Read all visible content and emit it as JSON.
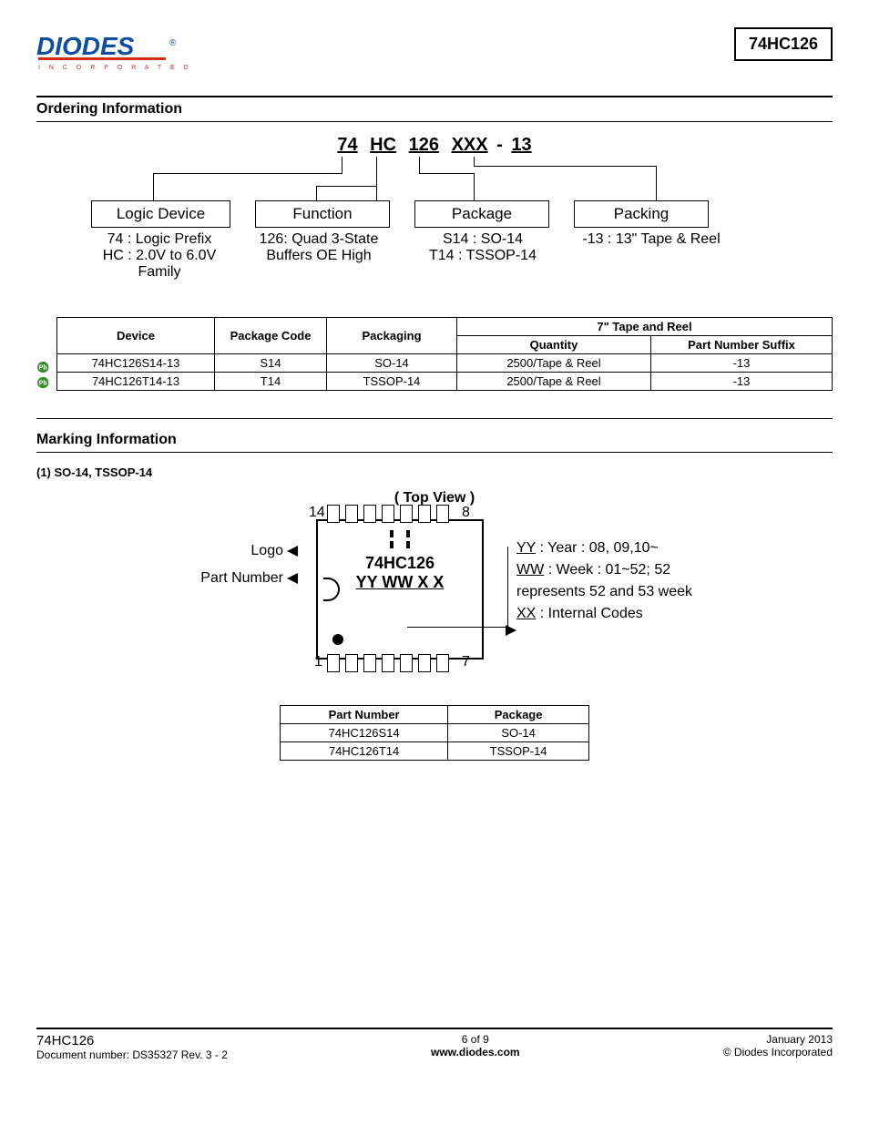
{
  "header": {
    "part_number": "74HC126"
  },
  "section1": {
    "title": "Ordering Information",
    "pn_format": {
      "p1": "74",
      "p2": "HC",
      "p3": "126",
      "p4": "XXX",
      "dash": "-",
      "p5": "13"
    },
    "groups": {
      "logic": {
        "label": "Logic Device",
        "line1": "74 : Logic Prefix",
        "line2": "HC : 2.0V to 6.0V",
        "line3": "Family"
      },
      "function": {
        "label": "Function",
        "line1": "126: Quad 3-State",
        "line2": "Buffers OE High"
      },
      "package": {
        "label": "Package",
        "line1": "S14 : SO-14",
        "line2": "T14 : TSSOP-14"
      },
      "packing": {
        "label": "Packing",
        "line1": "-13 : 13\" Tape & Reel"
      }
    }
  },
  "table1": {
    "headers": {
      "device": "Device",
      "pkgcode": "Package Code",
      "packaging": "Packaging",
      "tapereel": "7\" Tape and Reel",
      "qty": "Quantity",
      "suffix": "Part Number Suffix"
    },
    "rows": [
      {
        "device": "74HC126S14-13",
        "pkgcode": "S14",
        "packaging": "SO-14",
        "qty": "2500/Tape & Reel",
        "suffix": "-13"
      },
      {
        "device": "74HC126T14-13",
        "pkgcode": "T14",
        "packaging": "TSSOP-14",
        "qty": "2500/Tape & Reel",
        "suffix": "-13"
      }
    ]
  },
  "section2": {
    "title": "Marking Information",
    "subtitle": "(1) SO-14, TSSOP-14",
    "topview": "( Top View )",
    "pins": {
      "tl": "14",
      "tr": "8",
      "bl": "1",
      "br": "7"
    },
    "labels": {
      "logo": "Logo",
      "partno": "Part Number"
    },
    "chip": {
      "pn": "74HC126",
      "date": "YY WW X X"
    },
    "legend": {
      "l1a": "YY",
      "l1b": " : Year : 08, 09,10~",
      "l2a": "WW",
      "l2b": " : Week : 01~52; 52",
      "l3": "represents 52 and 53 week",
      "l4a": "XX",
      "l4b": " : Internal Codes"
    }
  },
  "table2": {
    "headers": {
      "pn": "Part Number",
      "pkg": "Package"
    },
    "rows": [
      {
        "pn": "74HC126S14",
        "pkg": "SO-14"
      },
      {
        "pn": "74HC126T14",
        "pkg": "TSSOP-14"
      }
    ]
  },
  "footer": {
    "left1": "74HC126",
    "left2": "Document number: DS35327  Rev. 3 - 2",
    "center1": "6 of 9",
    "center2": "www.diodes.com",
    "right1": "January 2013",
    "right2": "© Diodes Incorporated"
  }
}
